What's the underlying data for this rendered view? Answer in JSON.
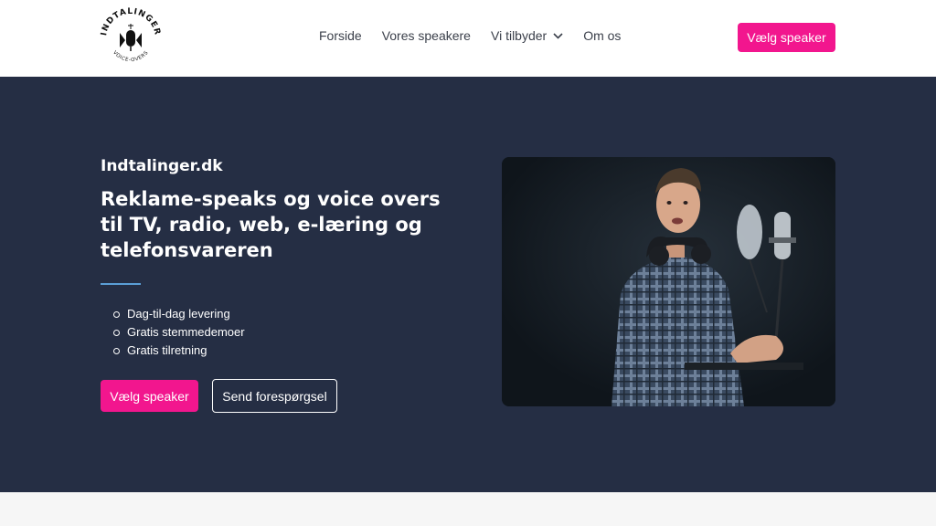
{
  "logo": {
    "text_top": "INDTALINGER",
    "text_bottom": "VOICE-OVERS"
  },
  "nav": {
    "items": [
      {
        "label": "Forside"
      },
      {
        "label": "Vores speakere"
      },
      {
        "label": "Vi tilbyder",
        "has_dropdown": true
      },
      {
        "label": "Om os"
      }
    ],
    "cta": "Vælg speaker"
  },
  "hero": {
    "brand": "Indtalinger.dk",
    "headline": "Reklame-speaks og voice overs til TV, radio, web, e-læring og telefonsvareren",
    "bullets": [
      "Dag-til-dag levering",
      "Gratis stemmedemoer",
      "Gratis tilretning"
    ],
    "primary_cta": "Vælg speaker",
    "secondary_cta": "Send forespørgsel"
  },
  "colors": {
    "accent": "#f2168e",
    "hero_background": "#252e44",
    "divider": "#5b9fd6"
  },
  "icons": {
    "logo": "microphone-logo-icon",
    "dropdown": "chevron-down-icon"
  }
}
